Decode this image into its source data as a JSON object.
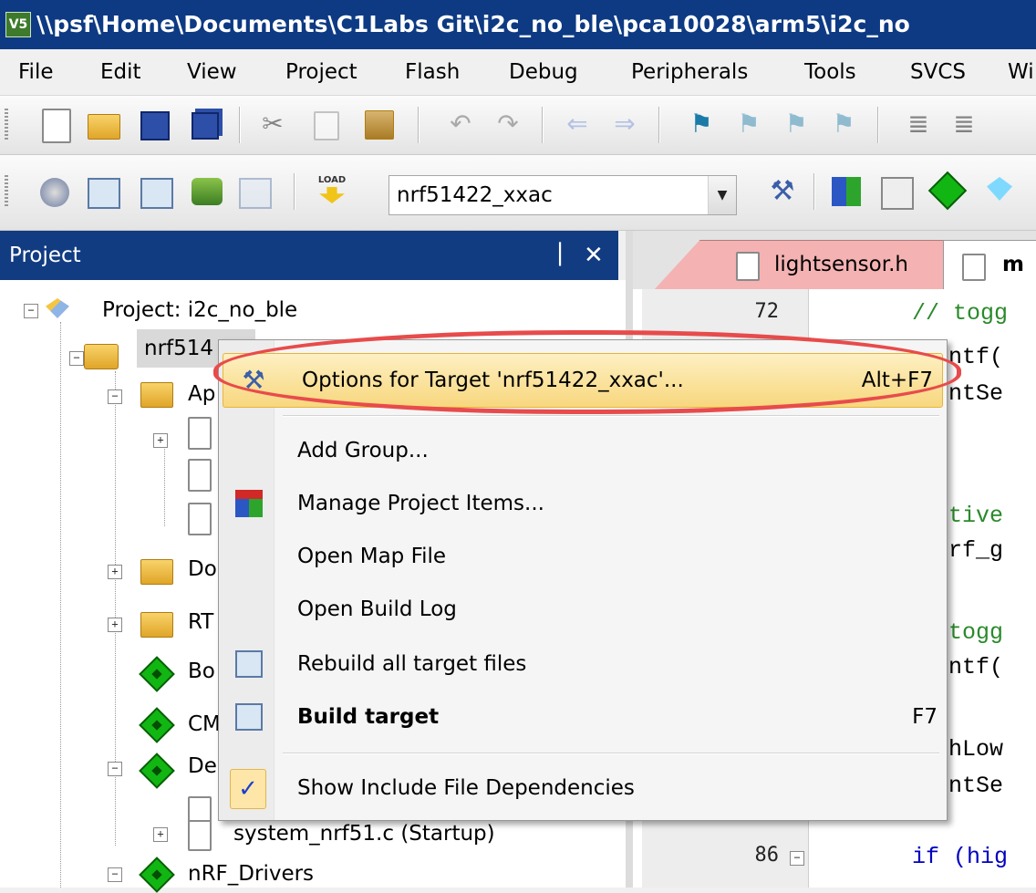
{
  "window": {
    "title": "\\\\psf\\Home\\Documents\\C1Labs Git\\i2c_no_ble\\pca10028\\arm5\\i2c_no",
    "app_icon_text": "V5"
  },
  "menubar": [
    "File",
    "Edit",
    "View",
    "Project",
    "Flash",
    "Debug",
    "Peripherals",
    "Tools",
    "SVCS",
    "Wi"
  ],
  "build_toolbar": {
    "load_label": "LOAD",
    "target_select": "nrf51422_xxac"
  },
  "project_pane": {
    "title": "Project",
    "pin": "▕",
    "close": "✕",
    "tree": [
      {
        "label": "Project: i2c_no_ble"
      },
      {
        "label": "nrf514"
      },
      {
        "label": "Ap"
      },
      {
        "label": "Do"
      },
      {
        "label": "RT"
      },
      {
        "label": "Bo"
      },
      {
        "label": "CM"
      },
      {
        "label": "De"
      },
      {
        "label": "system_nrf51.c (Startup)"
      },
      {
        "label": "nRF_Drivers"
      }
    ]
  },
  "editor": {
    "tabs": [
      {
        "label": "lightsensor.h",
        "active": false
      },
      {
        "label": "m",
        "active": true
      }
    ],
    "line_numbers": [
      "72",
      "86"
    ],
    "code_fragments": [
      "// togg",
      "ntf(",
      "ntSe",
      "tive",
      "rf_g",
      "togg",
      "ntf(",
      "hLow",
      "ntSe",
      "if (hig"
    ]
  },
  "context_menu": {
    "items": [
      {
        "label": "Options for Target 'nrf51422_xxac'...",
        "shortcut": "Alt+F7",
        "highlighted": true
      },
      {
        "label": "Add Group...",
        "shortcut": ""
      },
      {
        "label": "Manage Project Items...",
        "shortcut": ""
      },
      {
        "label": "Open Map File",
        "shortcut": ""
      },
      {
        "label": "Open Build Log",
        "shortcut": ""
      },
      {
        "label": "Rebuild all target files",
        "shortcut": ""
      },
      {
        "label": "Build target",
        "shortcut": "F7"
      },
      {
        "label": "Show Include File Dependencies",
        "shortcut": "",
        "checked": true
      }
    ],
    "check_glyph": "✓"
  },
  "colors": {
    "title_bar": "#0d3a83",
    "project_header": "#123c82",
    "menu_highlight": "#f8d77e",
    "annotation_ring": "#e84b4b",
    "tab_inactive": "#f4b2b2"
  }
}
